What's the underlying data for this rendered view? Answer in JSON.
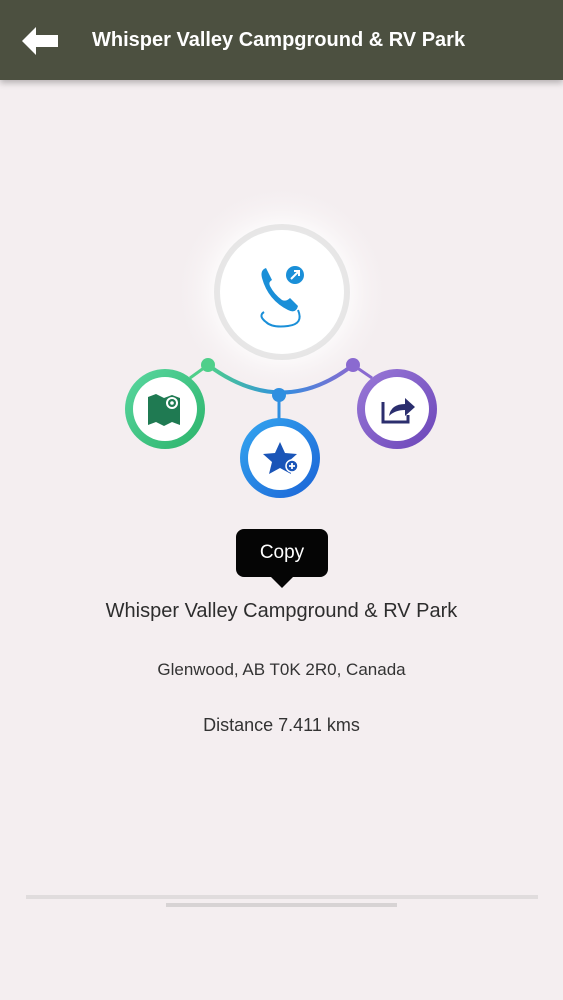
{
  "header": {
    "title": "Whisper Valley Campground & RV Park",
    "back_icon": "arrow-left-icon",
    "background": "#4c5040"
  },
  "actions": {
    "center_icon": "phone-icon",
    "left_icon": "map-icon",
    "bottom_icon": "star-add-icon",
    "right_icon": "share-icon",
    "colors": {
      "map": "#3fbf7a",
      "favorite": "#1e88e5",
      "share": "#7b5bc0",
      "phone": "#1a8fd8"
    }
  },
  "tooltip": {
    "label": "Copy"
  },
  "place": {
    "name": "Whisper Valley Campground & RV Park",
    "address": "Glenwood, AB T0K 2R0, Canada",
    "distance": "Distance 7.411 kms"
  }
}
